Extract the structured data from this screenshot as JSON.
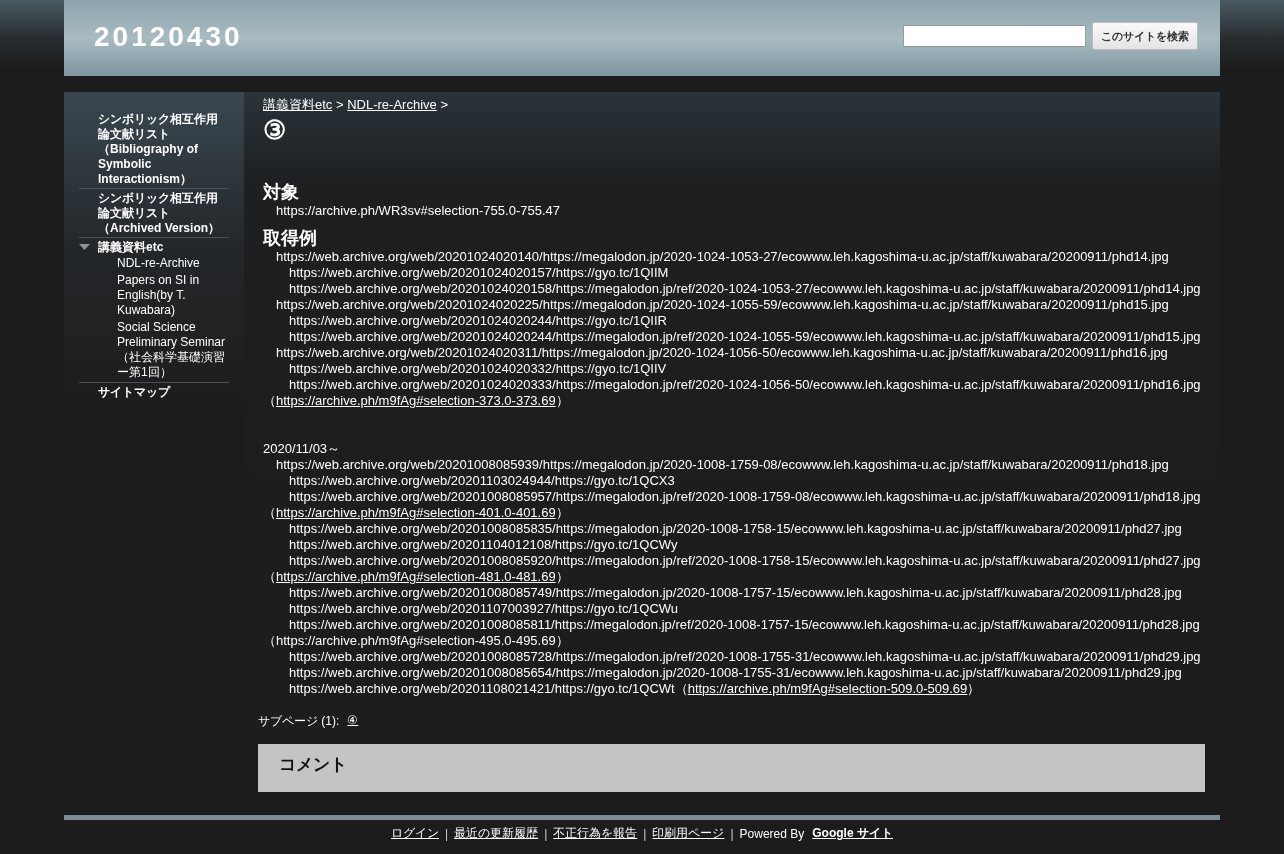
{
  "header": {
    "site_title": "20120430",
    "search": {
      "button": "このサイトを検索"
    }
  },
  "sidebar": {
    "items": [
      {
        "label": "シンボリック相互作用論文献リスト（Bibliography of Symbolic Interactionism）"
      },
      {
        "label": "シンボリック相互作用論文献リスト（Archived Version）"
      },
      {
        "label": "講義資料etc",
        "expanded": true,
        "children": [
          {
            "label": "NDL-re-Archive"
          },
          {
            "label": "Papers on SI in English(by T. Kuwabara)"
          },
          {
            "label": "Social Science Preliminary Seminar（社会科学基礎演習ー第1回）"
          }
        ]
      },
      {
        "label": "サイトマップ"
      }
    ]
  },
  "breadcrumb": [
    {
      "label": "講義資料etc",
      "separator": ">"
    },
    {
      "label": "NDL-re-Archive",
      "separator": ">"
    }
  ],
  "page_title": "③",
  "blocks": [
    {
      "heading": "対象",
      "lines": [
        {
          "kind": "main",
          "text": "https://archive.ph/WR3sv#selection-755.0-755.47"
        }
      ]
    },
    {
      "heading": "取得例",
      "lines": [
        {
          "kind": "main",
          "text": "https://web.archive.org/web/20201024020140/https://megalodon.jp/2020-1024-1053-27/ecowww.leh.kagoshima-u.ac.jp/staff/kuwabara/20200911/phd14.jpg"
        },
        {
          "kind": "sub",
          "text": "https://web.archive.org/web/20201024020157/https://gyo.tc/1QIIM"
        },
        {
          "kind": "sub",
          "text": "https://web.archive.org/web/20201024020158/https://megalodon.jp/ref/2020-1024-1053-27/ecowww.leh.kagoshima-u.ac.jp/staff/kuwabara/20200911/phd14.jpg"
        },
        {
          "kind": "main",
          "text": "https://web.archive.org/web/20201024020225/https://megalodon.jp/2020-1024-1055-59/ecowww.leh.kagoshima-u.ac.jp/staff/kuwabara/20200911/phd15.jpg"
        },
        {
          "kind": "sub",
          "text": "https://web.archive.org/web/20201024020244/https://gyo.tc/1QIIR"
        },
        {
          "kind": "sub",
          "text": "https://web.archive.org/web/20201024020244/https://megalodon.jp/ref/2020-1024-1055-59/ecowww.leh.kagoshima-u.ac.jp/staff/kuwabara/20200911/phd15.jpg"
        },
        {
          "kind": "main",
          "text": "https://web.archive.org/web/20201024020311/https://megalodon.jp/2020-1024-1056-50/ecowww.leh.kagoshima-u.ac.jp/staff/kuwabara/20200911/phd16.jpg"
        },
        {
          "kind": "sub",
          "text": "https://web.archive.org/web/20201024020332/https://gyo.tc/1QIIV"
        },
        {
          "kind": "sub",
          "text": "https://web.archive.org/web/20201024020333/https://megalodon.jp/ref/2020-1024-1056-50/ecowww.leh.kagoshima-u.ac.jp/staff/kuwabara/20200911/phd16.jpg"
        },
        {
          "kind": "note",
          "text": "（",
          "link": "https://archive.ph/m9fAg#selection-373.0-373.69",
          "suffix": "）"
        }
      ]
    },
    {
      "lines": [
        {
          "kind": "note",
          "text": "2020/11/03～"
        },
        {
          "kind": "main",
          "text": "https://web.archive.org/web/20201008085939/https://megalodon.jp/2020-1008-1759-08/ecowww.leh.kagoshima-u.ac.jp/staff/kuwabara/20200911/phd18.jpg"
        },
        {
          "kind": "sub",
          "text": "https://web.archive.org/web/20201103024944/https://gyo.tc/1QCX3"
        },
        {
          "kind": "sub",
          "text": "https://web.archive.org/web/20201008085957/https://megalodon.jp/ref/2020-1008-1759-08/ecowww.leh.kagoshima-u.ac.jp/staff/kuwabara/20200911/phd18.jpg"
        },
        {
          "kind": "note",
          "text": "（",
          "link": "https://archive.ph/m9fAg#selection-401.0-401.69",
          "suffix": "）"
        },
        {
          "kind": "sub",
          "text": "https://web.archive.org/web/20201008085835/https://megalodon.jp/2020-1008-1758-15/ecowww.leh.kagoshima-u.ac.jp/staff/kuwabara/20200911/phd27.jpg"
        },
        {
          "kind": "sub",
          "text": "https://web.archive.org/web/20201104012108/https://gyo.tc/1QCWy"
        },
        {
          "kind": "sub",
          "text": "https://web.archive.org/web/20201008085920/https://megalodon.jp/ref/2020-1008-1758-15/ecowww.leh.kagoshima-u.ac.jp/staff/kuwabara/20200911/phd27.jpg"
        },
        {
          "kind": "note",
          "text": "（",
          "link": "https://archive.ph/m9fAg#selection-481.0-481.69",
          "suffix": "）"
        },
        {
          "kind": "sub",
          "text": "https://web.archive.org/web/20201008085749/https://megalodon.jp/2020-1008-1757-15/ecowww.leh.kagoshima-u.ac.jp/staff/kuwabara/20200911/phd28.jpg"
        },
        {
          "kind": "sub",
          "text": "https://web.archive.org/web/20201107003927/https://gyo.tc/1QCWu"
        },
        {
          "kind": "sub",
          "text": "https://web.archive.org/web/20201008085811/https://megalodon.jp/ref/2020-1008-1757-15/ecowww.leh.kagoshima-u.ac.jp/staff/kuwabara/20200911/phd28.jpg"
        },
        {
          "kind": "note",
          "text": "（https://archive.ph/m9fAg#selection-495.0-495.69）"
        },
        {
          "kind": "sub",
          "text": "https://web.archive.org/web/20201008085728/https://megalodon.jp/ref/2020-1008-1755-31/ecowww.leh.kagoshima-u.ac.jp/staff/kuwabara/20200911/phd29.jpg"
        },
        {
          "kind": "sub",
          "text": "https://web.archive.org/web/20201008085654/https://megalodon.jp/2020-1008-1755-31/ecowww.leh.kagoshima-u.ac.jp/staff/kuwabara/20200911/phd29.jpg"
        },
        {
          "kind": "sub",
          "text": "https://web.archive.org/web/20201108021421/https://gyo.tc/1QCWt（",
          "link": "https://archive.ph/m9fAg#selection-509.0-509.69",
          "suffix": "）"
        }
      ]
    }
  ],
  "subpages": {
    "label": "サブページ (1):",
    "links": [
      "④"
    ]
  },
  "comments": {
    "title": "コメント"
  },
  "footer": {
    "links": [
      {
        "label": "ログイン",
        "separator": "|"
      },
      {
        "label": "最近の更新履歴",
        "separator": "|"
      },
      {
        "label": "不正行為を報告",
        "separator": "|"
      },
      {
        "label": "印刷用ページ",
        "separator": "|"
      }
    ],
    "powered_by": "Powered By",
    "brand": "Google サイト"
  }
}
